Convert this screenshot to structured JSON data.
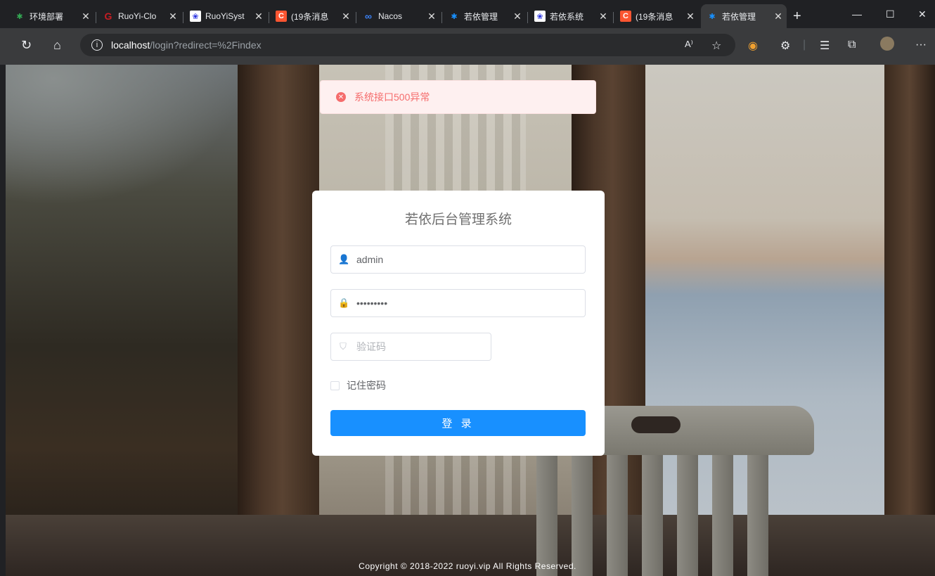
{
  "browser": {
    "tabs": [
      {
        "title": "环境部署",
        "icon": "leaf-icon",
        "icon_color": "#34a853",
        "active": false
      },
      {
        "title": "RuoYi-Clo",
        "icon": "gitee-icon",
        "icon_color": "#c71d23",
        "active": false
      },
      {
        "title": "RuoYiSyst",
        "icon": "baidu-icon",
        "icon_color": "#2932e1",
        "active": false
      },
      {
        "title": "(19条消息",
        "icon": "csdn-icon",
        "icon_color": "#fc5531",
        "active": false
      },
      {
        "title": "Nacos",
        "icon": "nacos-icon",
        "icon_color": "#3b82f6",
        "active": false
      },
      {
        "title": "若依管理",
        "icon": "ruoyi-icon",
        "icon_color": "#1890ff",
        "active": false
      },
      {
        "title": "若依系统",
        "icon": "baidu-icon",
        "icon_color": "#2932e1",
        "active": false
      },
      {
        "title": "(19条消息",
        "icon": "csdn-icon",
        "icon_color": "#fc5531",
        "active": false
      },
      {
        "title": "若依管理",
        "icon": "ruoyi-icon",
        "icon_color": "#1890ff",
        "active": true
      }
    ],
    "url_host": "localhost",
    "url_path": "/login?redirect=%2Findex"
  },
  "alert": {
    "message": "系统接口500异常",
    "color": "#f56c6c"
  },
  "login": {
    "title": "若依后台管理系统",
    "username_value": "admin",
    "password_value": "•••••••••",
    "captcha_placeholder": "验证码",
    "remember_label": "记住密码",
    "remember_checked": false,
    "submit_label": "登 录",
    "accent_color": "#1890ff"
  },
  "footer": {
    "copyright": "Copyright © 2018-2022 ruoyi.vip All Rights Reserved."
  }
}
